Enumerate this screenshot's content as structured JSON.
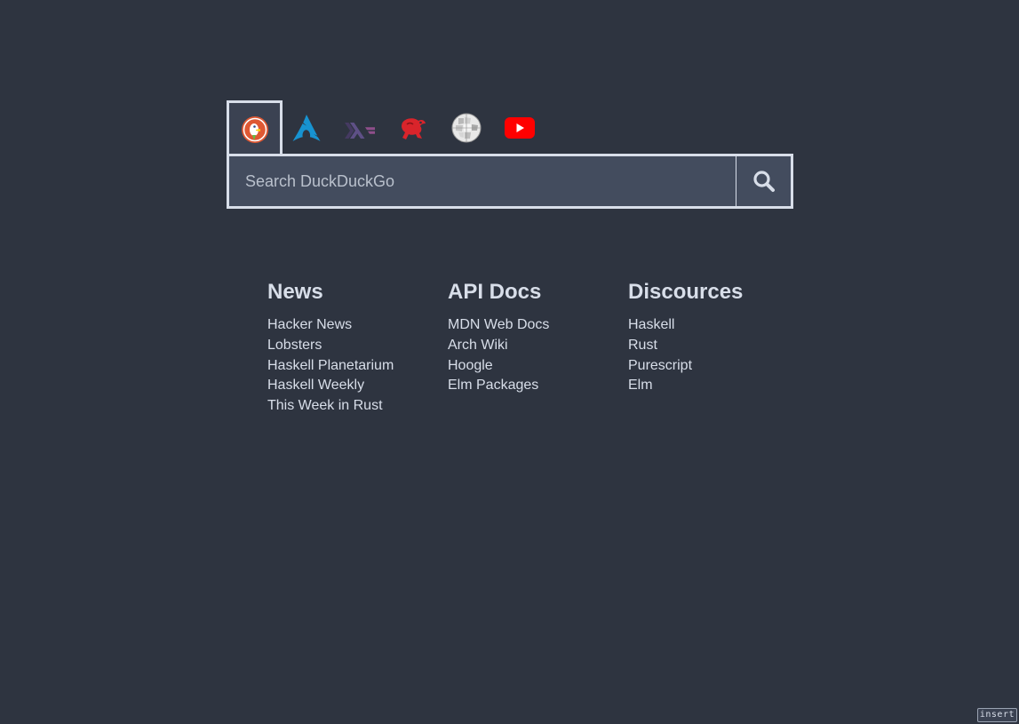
{
  "engines": [
    {
      "icon": "duckduckgo-icon",
      "active": true
    },
    {
      "icon": "arch-linux-icon",
      "active": false
    },
    {
      "icon": "haskell-icon",
      "active": false
    },
    {
      "icon": "hackage-icon",
      "active": false
    },
    {
      "icon": "wikipedia-icon",
      "active": false
    },
    {
      "icon": "youtube-icon",
      "active": false
    }
  ],
  "search": {
    "placeholder": "Search DuckDuckGo",
    "value": "",
    "button_icon": "search-icon"
  },
  "columns": [
    {
      "title": "News",
      "links": [
        "Hacker News",
        "Lobsters",
        "Haskell Planetarium",
        "Haskell Weekly",
        "This Week in Rust"
      ]
    },
    {
      "title": "API Docs",
      "links": [
        "MDN Web Docs",
        "Arch Wiki",
        "Hoogle",
        "Elm Packages"
      ]
    },
    {
      "title": "Discources",
      "links": [
        "Haskell",
        "Rust",
        "Purescript",
        "Elm"
      ]
    }
  ],
  "mode_indicator": "insert",
  "colors": {
    "background": "#2e3440",
    "text": "#d8dee9",
    "search_bg": "#434c5e",
    "border": "#d8dee9"
  }
}
